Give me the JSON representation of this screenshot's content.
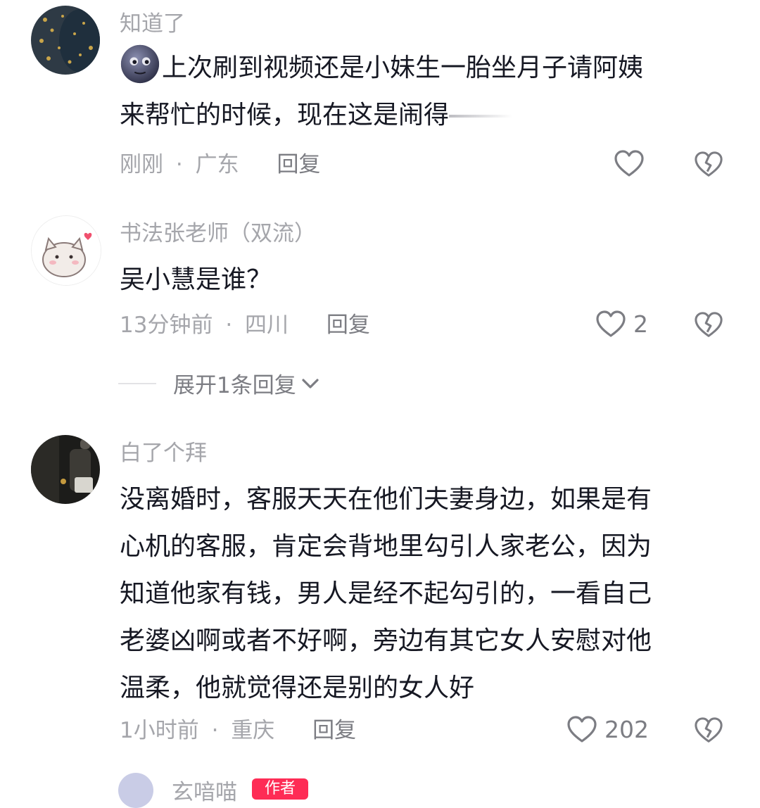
{
  "comments": [
    {
      "username": "知道了",
      "text_line1": "上次刷到视频还是小妹生一胎坐月子请阿姨",
      "text_line2_main": "来帮忙的时候，现在这是闹得",
      "text_line2_faded": "",
      "emoji": "moon-face-emoji",
      "time": "刚刚",
      "location": "广东",
      "reply": "回复",
      "likes": ""
    },
    {
      "username": "书法张老师（双流）",
      "text": "吴小慧是谁？",
      "time": "13分钟前",
      "location": "四川",
      "reply": "回复",
      "likes": "2",
      "expand": "展开1条回复"
    },
    {
      "username": "白了个拜",
      "text_lines": [
        "没离婚时，客服天天在他们夫妻身边，如果是有",
        "心机的客服，肯定会背地里勾引人家老公，因为",
        "知道他家有钱，男人是经不起勾引的，一看自己",
        "老婆凶啊或者不好啊，旁边有其它女人安慰对他",
        "温柔，他就觉得还是别的女人好"
      ],
      "time": "1小时前",
      "location": "重庆",
      "reply": "回复",
      "likes": "202"
    }
  ],
  "separator": "·",
  "next_comment": {
    "username": "玄喑喵",
    "badge": "作者"
  },
  "colors": {
    "meta": "#a5a6ab",
    "text": "#161823",
    "badge": "#fe2c55"
  }
}
